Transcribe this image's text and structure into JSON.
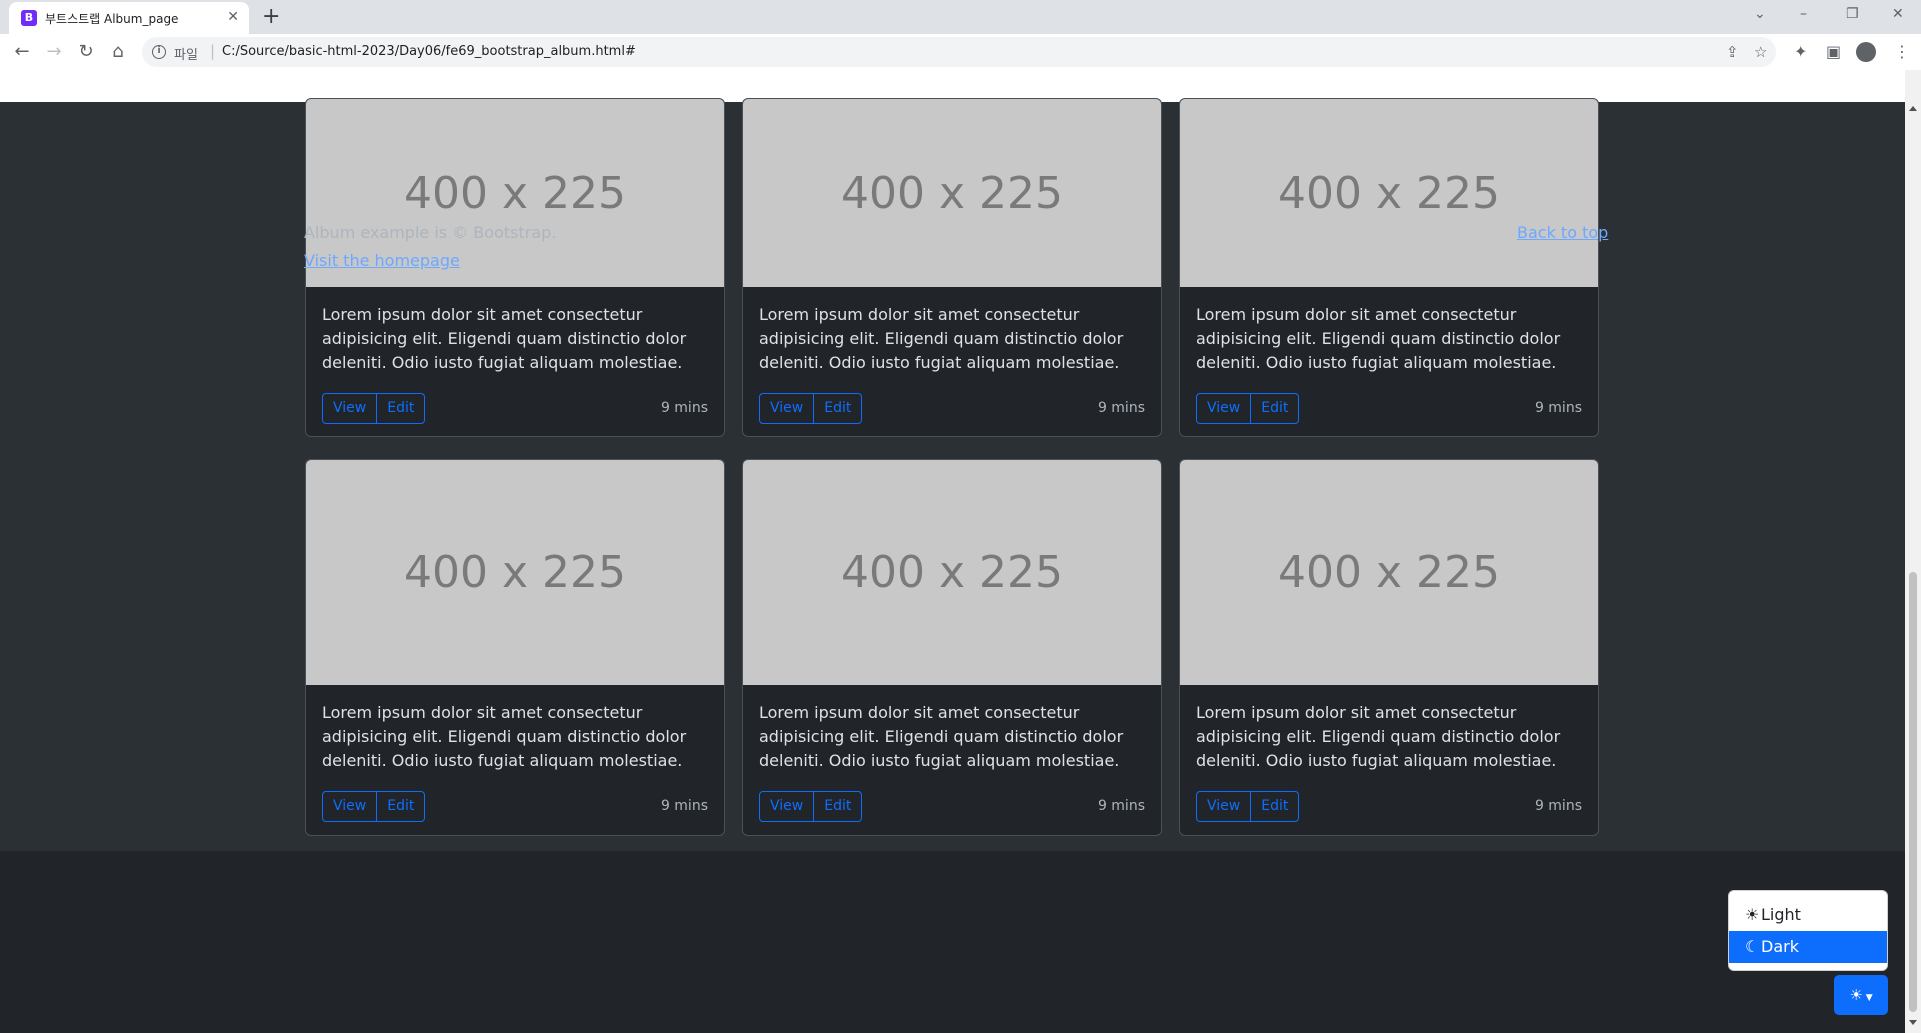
{
  "browser": {
    "tab_title": "부트스트랩 Album_page",
    "favicon_letter": "B",
    "url_scheme": "파일",
    "url": "C:/Source/basic-html-2023/Day06/fe69_bootstrap_album.html#"
  },
  "album": {
    "cards": [
      {
        "image_label": "400 x 225",
        "text": "Lorem ipsum dolor sit amet consectetur adipisicing elit. Eligendi quam distinctio dolor deleniti. Odio iusto fugiat aliquam molestiae.",
        "view_label": "View",
        "edit_label": "Edit",
        "time": "9 mins"
      },
      {
        "image_label": "400 x 225",
        "text": "Lorem ipsum dolor sit amet consectetur adipisicing elit. Eligendi quam distinctio dolor deleniti. Odio iusto fugiat aliquam molestiae.",
        "view_label": "View",
        "edit_label": "Edit",
        "time": "9 mins"
      },
      {
        "image_label": "400 x 225",
        "text": "Lorem ipsum dolor sit amet consectetur adipisicing elit. Eligendi quam distinctio dolor deleniti. Odio iusto fugiat aliquam molestiae.",
        "view_label": "View",
        "edit_label": "Edit",
        "time": "9 mins"
      },
      {
        "image_label": "400 x 225",
        "text": "Lorem ipsum dolor sit amet consectetur adipisicing elit. Eligendi quam distinctio dolor deleniti. Odio iusto fugiat aliquam molestiae.",
        "view_label": "View",
        "edit_label": "Edit",
        "time": "9 mins"
      },
      {
        "image_label": "400 x 225",
        "text": "Lorem ipsum dolor sit amet consectetur adipisicing elit. Eligendi quam distinctio dolor deleniti. Odio iusto fugiat aliquam molestiae.",
        "view_label": "View",
        "edit_label": "Edit",
        "time": "9 mins"
      },
      {
        "image_label": "400 x 225",
        "text": "Lorem ipsum dolor sit amet consectetur adipisicing elit. Eligendi quam distinctio dolor deleniti. Odio iusto fugiat aliquam molestiae.",
        "view_label": "View",
        "edit_label": "Edit",
        "time": "9 mins"
      }
    ]
  },
  "footer": {
    "text": "Album example is © Bootstrap.",
    "homepage_link": "Visit the homepage",
    "back_to_top": "Back to top"
  },
  "theme": {
    "options": [
      {
        "label": "Light",
        "icon": "sun-icon"
      },
      {
        "label": "Dark",
        "icon": "moon-icon"
      }
    ],
    "selected": "Dark",
    "accent": "#0d6efd"
  }
}
